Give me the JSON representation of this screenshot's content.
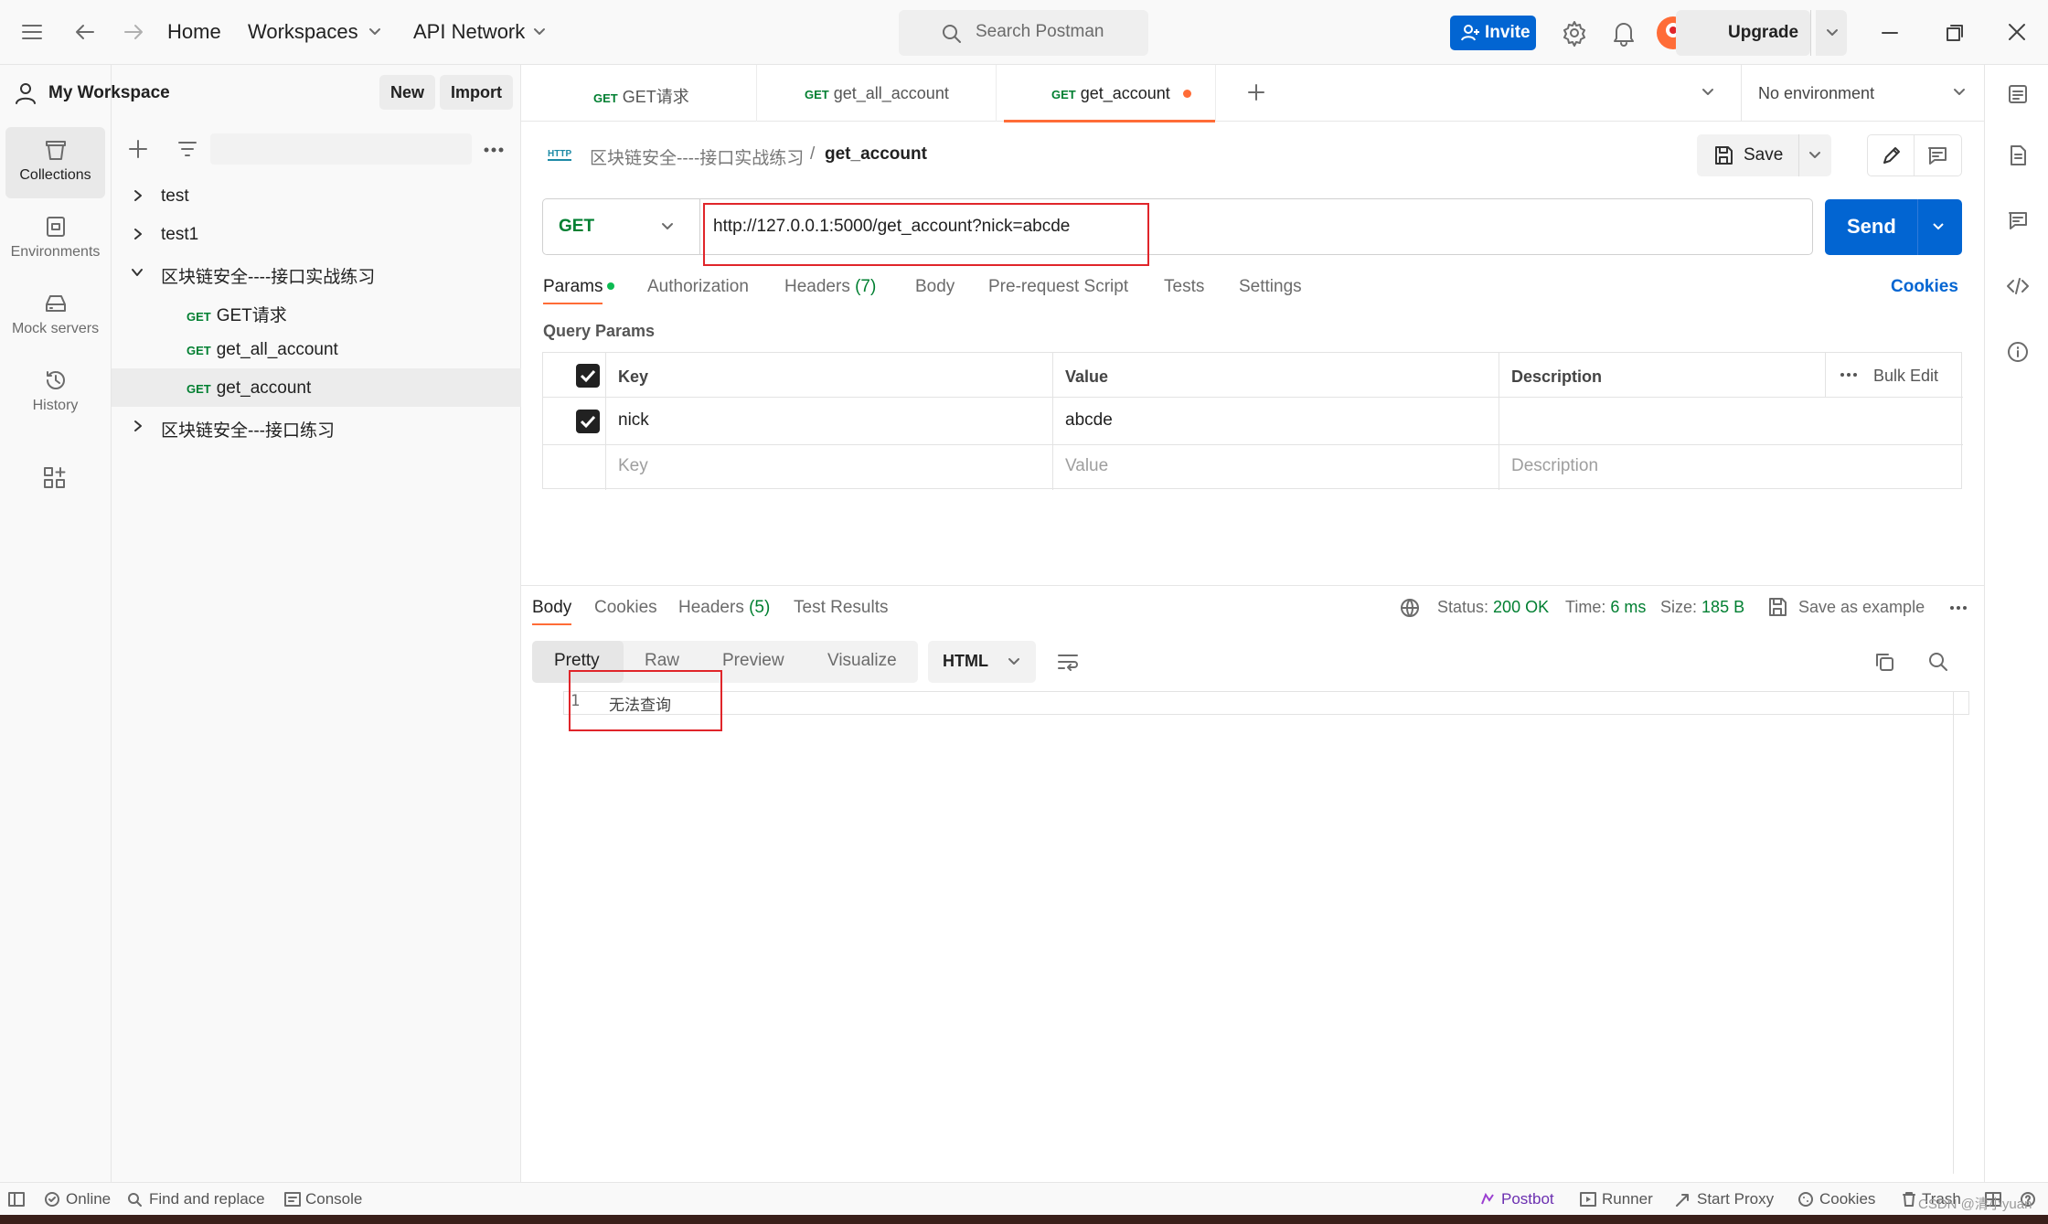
{
  "topbar": {
    "home": "Home",
    "workspaces": "Workspaces",
    "api_network": "API Network",
    "search_placeholder": "Search Postman",
    "invite": "Invite",
    "upgrade": "Upgrade"
  },
  "rail": {
    "items": [
      {
        "label": "Collections"
      },
      {
        "label": "Environments"
      },
      {
        "label": "Mock servers"
      },
      {
        "label": "History"
      }
    ]
  },
  "sidebar": {
    "workspace": "My Workspace",
    "new": "New",
    "import": "Import",
    "tree": [
      {
        "label": "test"
      },
      {
        "label": "test1"
      },
      {
        "label": "区块链安全----接口实战练习"
      },
      {
        "method": "GET",
        "label": "GET请求"
      },
      {
        "method": "GET",
        "label": "get_all_account"
      },
      {
        "method": "GET",
        "label": "get_account"
      },
      {
        "label": "区块链安全---接口练习"
      }
    ]
  },
  "tabs": [
    {
      "method": "GET",
      "label": "GET请求"
    },
    {
      "method": "GET",
      "label": "get_all_account"
    },
    {
      "method": "GET",
      "label": "get_account"
    }
  ],
  "environment": "No environment",
  "request": {
    "breadcrumb_parent": "区块链安全----接口实战练习",
    "breadcrumb_sep": "/",
    "name": "get_account",
    "save": "Save",
    "method": "GET",
    "url": "http://127.0.0.1:5000/get_account?nick=abcde",
    "send": "Send",
    "subtabs": {
      "params": "Params",
      "authorization": "Authorization",
      "headers": "Headers",
      "headers_count": "(7)",
      "body": "Body",
      "prerequest": "Pre-request Script",
      "tests": "Tests",
      "settings": "Settings",
      "cookies": "Cookies"
    },
    "query_params_title": "Query Params",
    "columns": {
      "key": "Key",
      "value": "Value",
      "description": "Description",
      "bulk_edit": "Bulk Edit"
    },
    "params": [
      {
        "key": "nick",
        "value": "abcde",
        "description": ""
      }
    ],
    "placeholders": {
      "key": "Key",
      "value": "Value",
      "description": "Description"
    }
  },
  "response": {
    "tabs": {
      "body": "Body",
      "cookies": "Cookies",
      "headers": "Headers",
      "headers_count": "(5)",
      "test_results": "Test Results"
    },
    "status_label": "Status:",
    "status_value": "200 OK",
    "time_label": "Time:",
    "time_value": "6 ms",
    "size_label": "Size:",
    "size_value": "185 B",
    "save_example": "Save as example",
    "formats": {
      "pretty": "Pretty",
      "raw": "Raw",
      "preview": "Preview",
      "visualize": "Visualize"
    },
    "language": "HTML",
    "line_number": "1",
    "body_text": "无法查询"
  },
  "statusbar": {
    "online": "Online",
    "find_replace": "Find and replace",
    "console": "Console",
    "postbot": "Postbot",
    "runner": "Runner",
    "start_proxy": "Start Proxy",
    "cookies": "Cookies",
    "trash": "Trash"
  },
  "watermark": "CSDN @清小yuan",
  "colors": {
    "accent": "#ff6c37",
    "primary": "#0265d2",
    "get": "#007f31",
    "highlight_box": "#e0252a"
  }
}
